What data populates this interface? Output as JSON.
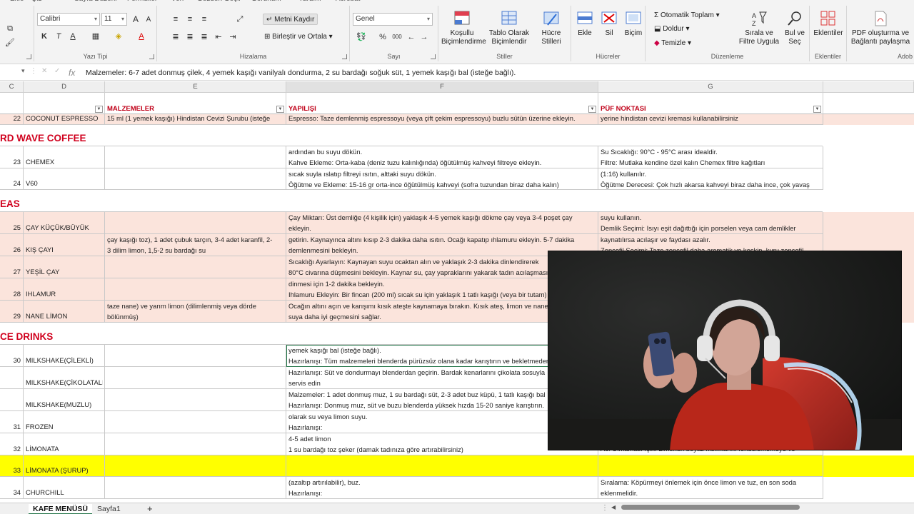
{
  "ribbon": {
    "font": {
      "name": "Calibri",
      "size": "11",
      "group_label": "Yazı Tipi",
      "bold": "K",
      "italic": "T",
      "underline": "A",
      "grow": "A",
      "shrink": "A"
    },
    "alignment": {
      "wrap_text": "Metni Kaydır",
      "merge_center": "Birleştir ve Ortala",
      "group_label": "Hizalama"
    },
    "number": {
      "format": "Genel",
      "group_label": "Sayı",
      "percent": "%",
      "comma": "000"
    },
    "styles": {
      "conditional": "Koşullu Biçimlendirme",
      "format_table": "Tablo Olarak Biçimlendir",
      "cell_styles": "Hücre Stilleri",
      "group_label": "Stiller"
    },
    "cells": {
      "insert": "Ekle",
      "delete": "Sil",
      "format": "Biçim",
      "group_label": "Hücreler"
    },
    "editing": {
      "autosum": "Otomatik Toplam",
      "fill": "Doldur",
      "clear": "Temizle",
      "sort_filter": "Sırala ve Filtre Uygula",
      "find_select": "Bul ve Seç",
      "group_label": "Düzenleme"
    },
    "addins": {
      "label": "Eklentiler",
      "group_label": "Eklentiler"
    },
    "pdf": {
      "label": "PDF oluşturma ve Bağlantı paylaşma",
      "group_label": "Adob"
    },
    "top_tabs": [
      "Ekle",
      "Çiz",
      "Sayfa Düzeni",
      "Formüller",
      "Veri",
      "Gözden Geçir",
      "Görünüm",
      "Yardım",
      "Acrobat"
    ]
  },
  "formula_bar": {
    "name_box": "",
    "fx": "fx",
    "formula": "Malzemeler: 6-7 adet donmuş çilek, 4 yemek kaşığı vanilyalı dondurma, 2 su bardağı soğuk süt, 1 yemek kaşığı bal (isteğe bağlı)."
  },
  "columns": [
    "C",
    "D",
    "E",
    "F",
    "G"
  ],
  "headers": {
    "malzemeler": "MALZEMELER",
    "yapilisi": "YAPILIŞI",
    "puf": "PÜF NOKTASI"
  },
  "sections": {
    "third_wave": "RD WAVE COFFEE",
    "teas": "EAS",
    "ice_drinks": "CE DRINKS"
  },
  "rows": {
    "r22": {
      "num": "22",
      "name": "COCONUT ESPRESSO",
      "e1": "15 ml (1 yemek kaşığı) Hindistan Cevizi Şurubu (isteğe",
      "f1": "Espresso: Taze demlenmiş espressoyu (veya çift çekim espressoyu) buzlu sütün üzerine ekleyin.",
      "g1": "yerine hindistan cevizi kremasi kullanabilirsiniz"
    },
    "r23": {
      "num": "23",
      "name": "CHEMEX",
      "f1": "ardından bu suyu dökün.",
      "f2": "Kahve Ekleme: Orta-kaba (deniz tuzu kalınlığında) öğütülmüş kahveyi filtreye ekleyin.",
      "g1": "Su Sıcaklığı: 90°C - 95°C arası idealdir.",
      "g2": "Filtre: Mutlaka kendine özel kalın Chemex filtre kağıtları"
    },
    "r24": {
      "num": "24",
      "name": "V60",
      "f1": "sıcak suyla ıslatıp filtreyi ısıtın, alttaki suyu dökün.",
      "f2": "Öğütme ve Ekleme: 15-16 gr orta-ince öğütülmüş kahveyi (sofra tuzundan biraz daha kalın)",
      "g1": "(1:16) kullanılır.",
      "g2": "Öğütme Derecesi: Çok hızlı akarsa kahveyi biraz daha ince, çok yavaş"
    },
    "r25": {
      "num": "25",
      "name": "ÇAY KÜÇÜK/BÜYÜK",
      "f1": "Çay Miktarı: Üst demliğe (4 kişilik için) yaklaşık 4-5 yemek kaşığı dökme çay veya 3-4 poşet çay",
      "f2": "ekleyin.",
      "g1": "suyu kullanın.",
      "g2": "Demlik Seçimi: Isıyı eşit dağıttığı için porselen veya cam demlikler"
    },
    "r26": {
      "num": "26",
      "name": "KIŞ ÇAYI",
      "e1": "çay kaşığı toz), 1 adet çubuk tarçın, 3-4 adet karanfil, 2-",
      "e2": "3 dilim limon, 1,5-2 su bardağı su",
      "f1": "getirin. Kaynayınca altını kısıp 2-3 dakika daha ısıtın. Ocağı kapatıp ıhlamuru ekleyin. 5-7 dakika",
      "f2": "demlenmesini bekleyin.",
      "g1": "kaynatılırsa acılaşır ve faydası azalır.",
      "g2": "Zencefil Seçimi: Taze zencefil daha aromatik ve keskin, kuru zencefil"
    },
    "r27": {
      "num": "27",
      "name": "YEŞİL ÇAY",
      "f1": "Sıcaklığı Ayarlayın: Kaynayan suyu ocaktan alın ve yaklaşık 2-3 dakika dinlendirerek",
      "f2": "80°C civarına düşmesini bekleyin. Kaynar su, çay yapraklarını yakarak tadın acılaşmasına"
    },
    "r28": {
      "num": "28",
      "name": "IHLAMUR",
      "f1": "dinmesi için 1-2 dakika bekleyin.",
      "f2": "Ihlamuru Ekleyin: Bir fincan (200 ml) sıcak su için yaklaşık 1 tatlı kaşığı (veya bir tutam)"
    },
    "r29": {
      "num": "29",
      "name": "NANE LİMON",
      "e1": "taze nane) ve yarım limon (dilimlenmiş veya dörde",
      "e2": "bölünmüş)",
      "f1": "Ocağın altını açın ve karışımı kısık ateşte kaynamaya bırakın. Kısık ateş, limon ve nanenin",
      "f2": "suya daha iyi geçmesini sağlar."
    },
    "r30": {
      "num": "30",
      "name": "MILKSHAKE(ÇİLEKLİ)",
      "f1": "yemek kaşığı bal (isteğe bağlı).",
      "f2": "Hazırlanışı: Tüm malzemeleri blenderda pürüzsüz olana kadar karıştırın ve bekletmeden"
    },
    "r30b": {
      "num": "",
      "name": "MILKSHAKE(ÇİKOLATALI)",
      "f1": "Hazırlanışı: Süt ve dondurmayı blenderdan geçirin. Bardak kenarlarını çikolata sosuyla",
      "f2": "servis edin"
    },
    "r30c": {
      "num": "",
      "name": "MILKSHAKE(MUZLU)",
      "f1": "Malzemeler: 1 adet donmuş muz, 1 su bardağı süt, 2-3 adet buz küpü, 1 tatlı kaşığı bal",
      "f2": "Hazırlanışı: Donmuş muz, süt ve buzu blenderda yüksek hızda 15-20 saniye karıştırın."
    },
    "r31": {
      "num": "31",
      "name": "FROZEN",
      "f1": "olarak su veya limon suyu.",
      "f2": "Hazırlanışı:"
    },
    "r32": {
      "num": "32",
      "name": "LİMONATA",
      "f1": "4-5 adet limon",
      "f2": "1 su bardağı toz şeker (damak tadınıza göre artırabilirsiniz)",
      "g1": "Acı Olmaması İçin: Limonun beyaz kısımlarını fendelememeye ve"
    },
    "r33": {
      "num": "33",
      "name": "LİMONATA (ŞURUP)"
    },
    "r34": {
      "num": "34",
      "name": "CHURCHILL",
      "f1": "(azaltıp artırılabilir), buz.",
      "f2": "Hazırlanışı:",
      "g1": "Sıralama: Köpürmeyi önlemek için önce limon ve tuz, en son soda",
      "g2": "eklenmelidir."
    }
  },
  "sheets": {
    "active": "KAFE MENÜSÜ",
    "other": "Sayfa1",
    "add": "+"
  },
  "colors": {
    "accent_red": "#d0001d",
    "pink_fill": "#fbe4dc",
    "yellow_fill": "#ffff00",
    "excel_green": "#217346"
  }
}
